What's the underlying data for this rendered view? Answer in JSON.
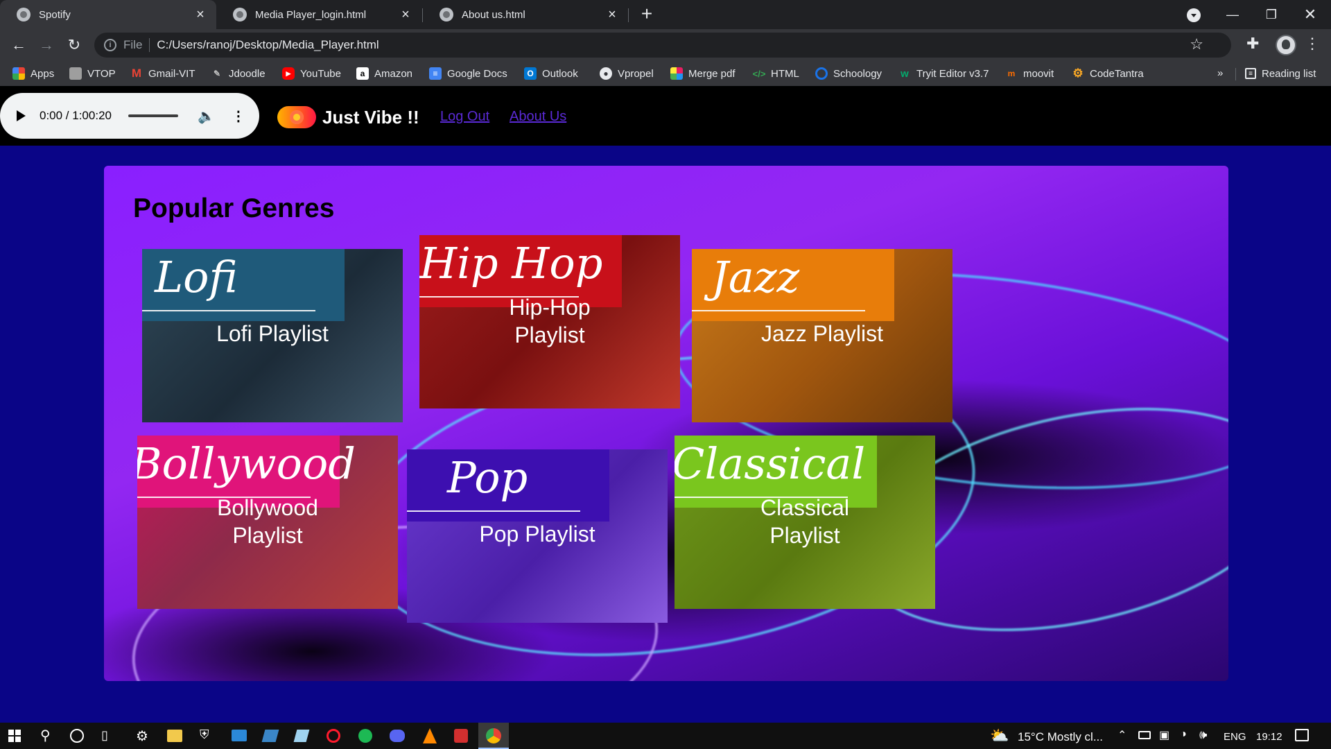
{
  "browser": {
    "tabs": [
      {
        "title": "Spotify",
        "active": true
      },
      {
        "title": "Media Player_login.html",
        "active": false
      },
      {
        "title": "About us.html",
        "active": false
      }
    ],
    "address": {
      "scheme": "File",
      "url": "C:/Users/ranoj/Desktop/Media_Player.html"
    },
    "bookmarks": [
      {
        "label": "Apps",
        "icon": "apps-grid-icon",
        "color": "#4285f4"
      },
      {
        "label": "VTOP",
        "icon": "vtop-icon",
        "color": "#9e9e9e"
      },
      {
        "label": "Gmail-VIT",
        "icon": "gmail-icon",
        "color": "#ea4335"
      },
      {
        "label": "Jdoodle",
        "icon": "jdoodle-icon",
        "color": "#424242"
      },
      {
        "label": "YouTube",
        "icon": "youtube-icon",
        "color": "#ff0000"
      },
      {
        "label": "Amazon",
        "icon": "amazon-icon",
        "color": "#ffffff"
      },
      {
        "label": "Google Docs",
        "icon": "google-docs-icon",
        "color": "#4285f4"
      },
      {
        "label": "Outlook",
        "icon": "outlook-icon",
        "color": "#0078d4"
      },
      {
        "label": "Vpropel",
        "icon": "globe-icon",
        "color": "#e8eaed"
      },
      {
        "label": "Merge pdf",
        "icon": "merge-pdf-icon",
        "color": "#e91e63"
      },
      {
        "label": "HTML",
        "icon": "code-icon",
        "color": "#34a853"
      },
      {
        "label": "Schoology",
        "icon": "schoology-icon",
        "color": "#1a73e8"
      },
      {
        "label": "Tryit Editor v3.7",
        "icon": "w3schools-icon",
        "color": "#04aa6d"
      },
      {
        "label": "moovit",
        "icon": "moovit-icon",
        "color": "#ff6d00"
      },
      {
        "label": "CodeTantra",
        "icon": "codetantra-icon",
        "color": "#f9a825"
      }
    ],
    "bookmarks_more": "»",
    "reading_list": "Reading list"
  },
  "player": {
    "time": "0:00 / 1:00:20",
    "progress": 0
  },
  "header": {
    "brand": "Just Vibe !!",
    "links": [
      "Log Out",
      "About Us"
    ]
  },
  "main": {
    "title": "Popular Genres",
    "genres": [
      {
        "script": "Lofi",
        "label_lines": [
          "Lofi Playlist"
        ],
        "banner_color": "#1f5a7a",
        "photo_color": "#2c3e50"
      },
      {
        "script": "Hip Hop",
        "label_lines": [
          "Hip-Hop",
          "Playlist"
        ],
        "banner_color": "#c8101a",
        "photo_color": "#8e1a1a"
      },
      {
        "script": "Jazz",
        "label_lines": [
          "Jazz Playlist"
        ],
        "banner_color": "#e87d0a",
        "photo_color": "#b05a10"
      },
      {
        "script": "Bollywood",
        "label_lines": [
          "Bollywood",
          "Playlist"
        ],
        "banner_color": "#e0147a",
        "photo_color": "#b0305a"
      },
      {
        "script": "Pop",
        "label_lines": [
          "Pop Playlist"
        ],
        "banner_color": "#3d0fb0",
        "photo_color": "#6a3ad0"
      },
      {
        "script": "Classical",
        "label_lines": [
          "Classical",
          "Playlist"
        ],
        "banner_color": "#7ac61e",
        "photo_color": "#6a8a14"
      }
    ]
  },
  "taskbar": {
    "weather": "15°C  Mostly cl...",
    "language": "ENG",
    "clock": "19:12"
  }
}
